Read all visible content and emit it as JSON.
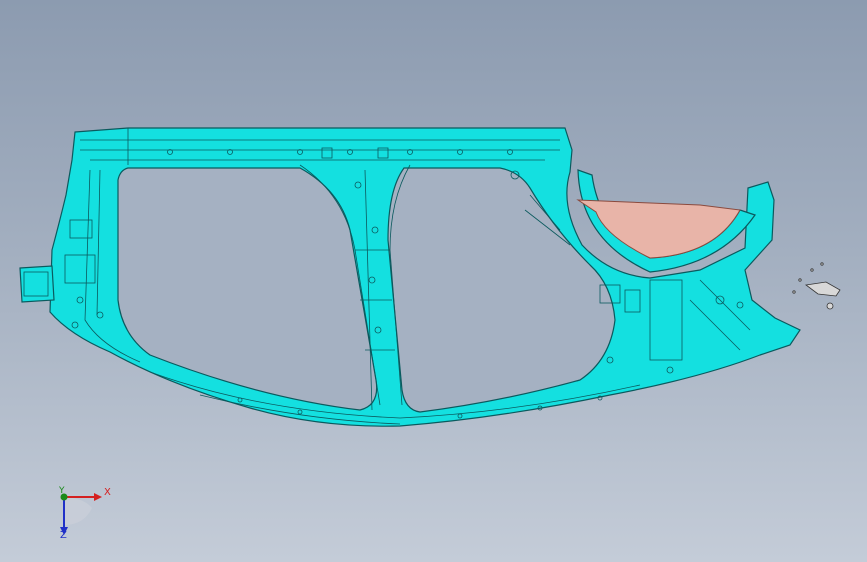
{
  "window": {
    "title": ""
  },
  "viewport": {
    "background_top": "#8c9bb0",
    "background_bottom": "#c4ccd8",
    "model_color": "#14e0e0",
    "model_edge_color": "#0b5a5e",
    "highlight_part_color": "#e8b4a8"
  },
  "triad": {
    "x_label": "X",
    "y_label": "Y",
    "z_label": "Z",
    "x_color": "#d42020",
    "y_color": "#1a8a1a",
    "z_color": "#2030c8"
  },
  "icons": [
    "coordinate-triad-icon"
  ]
}
